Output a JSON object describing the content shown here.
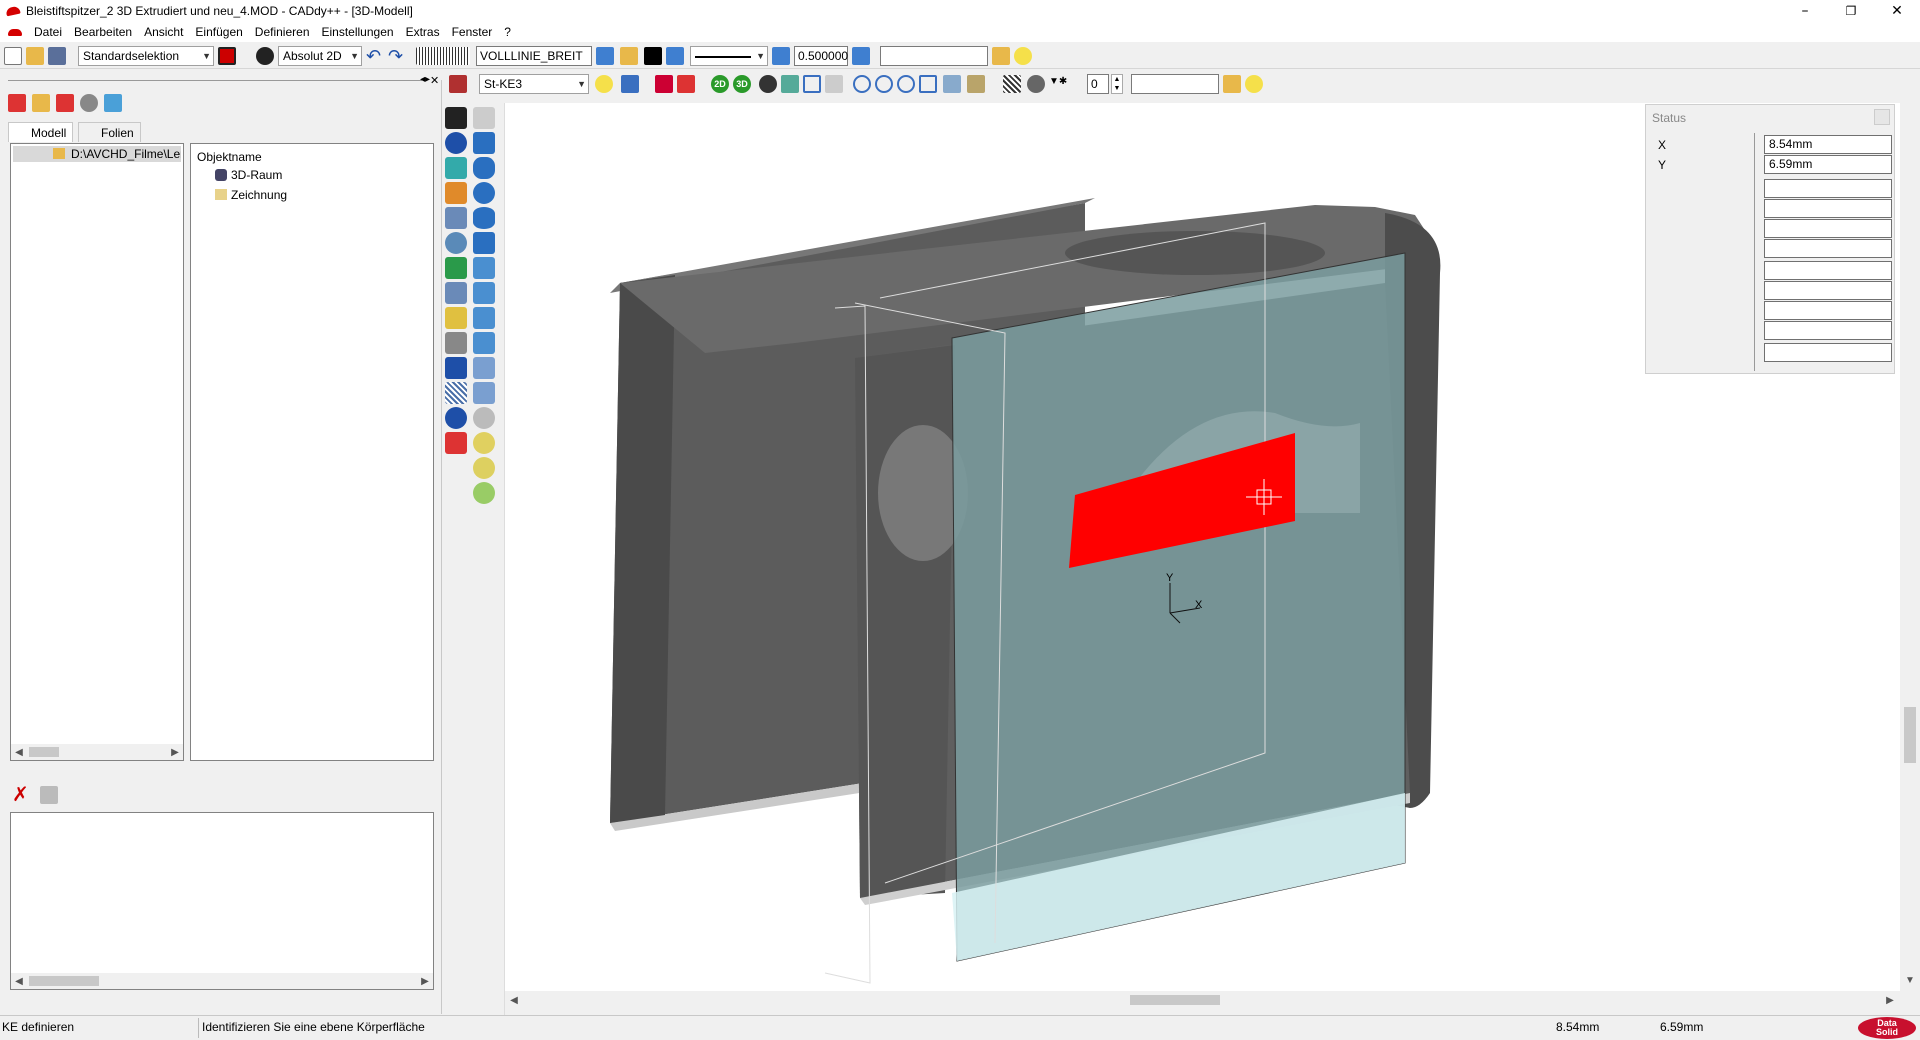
{
  "window": {
    "title": "Bleistiftspitzer_2 3D Extrudiert und neu_4.MOD  -  CADdy++ - [3D-Modell]"
  },
  "menu": [
    "Datei",
    "Bearbeiten",
    "Ansicht",
    "Einfügen",
    "Definieren",
    "Einstellungen",
    "Extras",
    "Fenster",
    "?"
  ],
  "toolbar1": {
    "selection_mode": "Standardselektion",
    "coord_mode": "Absolut 2D",
    "line_type": "VOLLLINIE_BREIT",
    "line_width": "0.500000",
    "layer_input": ""
  },
  "toolbar2": {
    "ke_select": "St-KE3",
    "count_value": "0",
    "extra_input": ""
  },
  "left_panel": {
    "tabs": [
      "Modell",
      "Folien"
    ],
    "tree_root": "D:\\AVCHD_Filme\\Lern",
    "object_header": "Objektname",
    "objects": [
      "3D-Raum",
      "Zeichnung"
    ]
  },
  "status_panel": {
    "title": "Status",
    "x_label": "X",
    "x_value": "8.54mm",
    "y_label": "Y",
    "y_value": "6.59mm"
  },
  "axis_labels": {
    "y": "Y",
    "x": "X"
  },
  "statusbar": {
    "command": "KE definieren",
    "prompt": "Identifizieren Sie eine ebene Körperfläche",
    "x": "8.54mm",
    "y": "6.59mm",
    "logo_top": "Data",
    "logo_bottom": "Solid"
  },
  "colors": {
    "accent": "#d40000",
    "model_dark": "#5b5b5b",
    "plane": "#6f8f92",
    "highlight": "#ff0000"
  }
}
